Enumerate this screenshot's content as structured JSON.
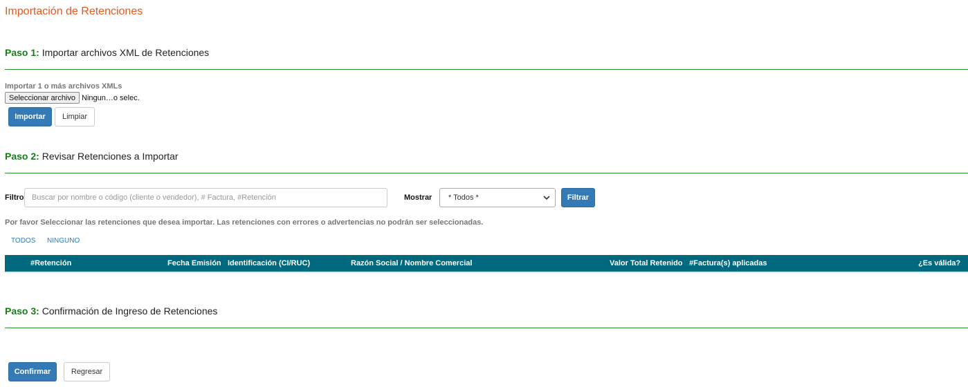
{
  "page": {
    "title": "Importación de Retenciones"
  },
  "step1": {
    "num": "Paso 1:",
    "title": " Importar archivos XML de Retenciones",
    "upload_label": "Importar 1 o más archivos XMLs",
    "file_button": "Seleccionar archivo",
    "file_status": "Ningun…o selec.",
    "import_button": "Importar",
    "clear_button": "Limpiar"
  },
  "step2": {
    "num": "Paso 2:",
    "title": " Revisar Retenciones a Importar",
    "filter_label": "Filtro",
    "filter_placeholder": "Buscar por nombre o código (cliente o vendedor), # Factura, #Retención",
    "show_label": "Mostrar",
    "show_selected": "* Todos *",
    "filter_button": "Filtrar",
    "help_text": "Por favor Seleccionar las retenciones que desea importar. Las retenciones con errores o advertencias no podrán ser seleccionadas.",
    "select_all": "TODOS",
    "select_none": "NINGUNO",
    "table_columns": [
      "#Retención",
      "Fecha Emisión",
      "Identificación (CI/RUC)",
      "Razón Social / Nombre Comercial",
      "Valor Total Retenido",
      "#Factura(s) aplicadas",
      "¿Es válida?"
    ]
  },
  "step3": {
    "num": "Paso 3:",
    "title": " Confirmación de Ingreso de Retenciones",
    "confirm_button": "Confirmar",
    "back_button": "Regresar"
  },
  "colors": {
    "title_orange": "#e8581c",
    "step_green": "#1b7a1b",
    "primary_blue": "#337ab7",
    "table_header_teal": "#006980"
  }
}
